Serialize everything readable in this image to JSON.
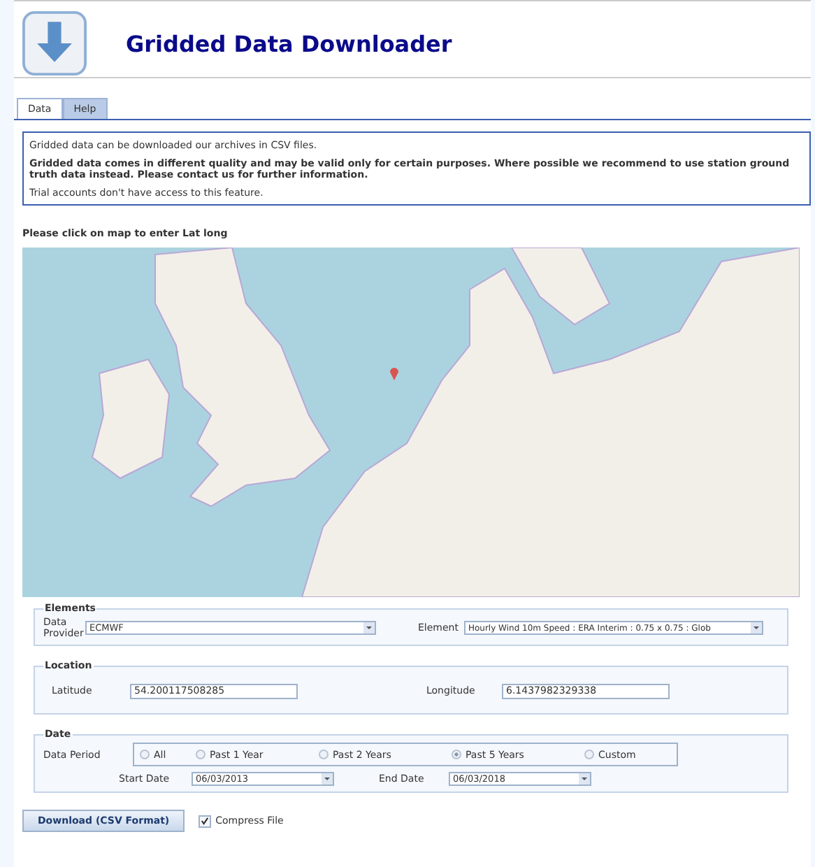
{
  "header": {
    "title": "Gridded Data Downloader"
  },
  "tabs": [
    {
      "label": "Data",
      "selected": true
    },
    {
      "label": "Help",
      "selected": false
    }
  ],
  "info": {
    "intro": "Gridded data can be downloaded our archives in CSV files.",
    "warning": "Gridded data comes in different quality and may be valid only for certain purposes. Where possible we recommend to use station ground truth data instead. Please contact us for further information.",
    "note": "Trial accounts don't have access to this feature."
  },
  "map_prompt": "Please click on map to enter Lat long",
  "elements": {
    "legend": "Elements",
    "provider_label": "Data Provider",
    "provider_value": "ECMWF",
    "element_label": "Element",
    "element_value": "Hourly Wind 10m Speed : ERA Interim : 0.75 x 0.75 : Glob"
  },
  "location": {
    "legend": "Location",
    "latitude_label": "Latitude",
    "latitude_value": "54.200117508285",
    "longitude_label": "Longitude",
    "longitude_value": "6.1437982329338"
  },
  "date": {
    "legend": "Date",
    "period_label": "Data Period",
    "periods": [
      {
        "label": "All",
        "selected": false
      },
      {
        "label": "Past 1 Year",
        "selected": false
      },
      {
        "label": "Past 2 Years",
        "selected": false
      },
      {
        "label": "Past 5 Years",
        "selected": true
      },
      {
        "label": "Custom",
        "selected": false
      }
    ],
    "start_label": "Start Date",
    "start_value": "06/03/2013",
    "end_label": "End Date",
    "end_value": "06/03/2018"
  },
  "download_button": "Download (CSV Format)",
  "compress": {
    "label": "Compress File",
    "checked": true
  }
}
